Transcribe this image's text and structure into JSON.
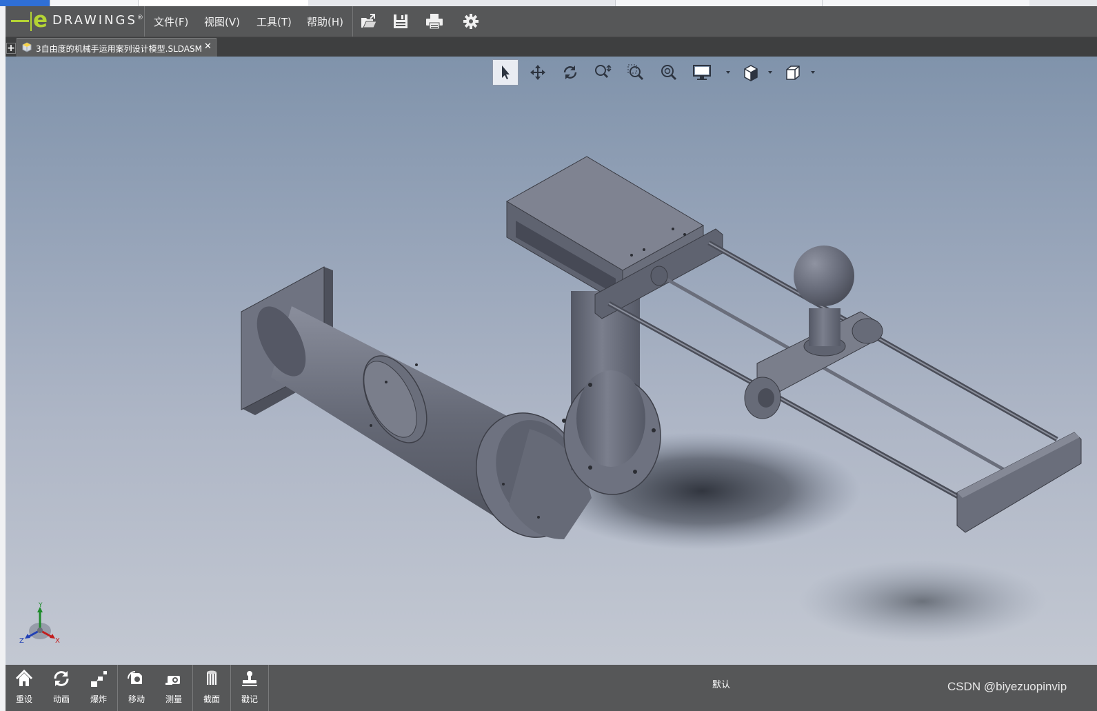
{
  "app": {
    "logo_letter": "e",
    "logo_text": "DRAWINGS",
    "logo_mark": "®"
  },
  "menu": {
    "items": [
      {
        "label": "文件(F)"
      },
      {
        "label": "视图(V)"
      },
      {
        "label": "工具(T)"
      },
      {
        "label": "帮助(H)"
      }
    ]
  },
  "toolbar": {
    "buttons": [
      {
        "icon": "open-folder-icon"
      },
      {
        "icon": "save-icon"
      },
      {
        "icon": "print-icon"
      },
      {
        "icon": "settings-gear-icon"
      }
    ]
  },
  "tabs": {
    "new_tab": "+",
    "document": {
      "title": "3自由度的机械手运用案列设计模型.SLDASM",
      "close": "✕"
    }
  },
  "view_toolbar": {
    "tools": [
      {
        "icon": "select-arrow-icon",
        "active": true
      },
      {
        "icon": "pan-move-icon"
      },
      {
        "icon": "rotate-icon"
      },
      {
        "icon": "zoom-icon"
      },
      {
        "icon": "zoom-to-area-icon"
      },
      {
        "icon": "zoom-to-fit-icon"
      },
      {
        "icon": "display-style-icon",
        "dropdown": true
      },
      {
        "icon": "view-orientation-icon",
        "dropdown": true
      },
      {
        "icon": "standard-view-cube-icon",
        "dropdown": true
      }
    ]
  },
  "triad": {
    "x": "X",
    "y": "Y",
    "z": "Z"
  },
  "bottom_toolbar": {
    "items": [
      {
        "label": "重设",
        "icon": "home-reset-icon"
      },
      {
        "label": "动画",
        "icon": "animate-icon"
      },
      {
        "label": "爆炸",
        "icon": "explode-icon"
      },
      {
        "label": "移动",
        "icon": "move-component-icon"
      },
      {
        "label": "测量",
        "icon": "measure-icon"
      },
      {
        "label": "截面",
        "icon": "section-icon"
      },
      {
        "label": "戳记",
        "icon": "stamp-icon"
      }
    ]
  },
  "status": {
    "configuration": "默认"
  },
  "watermark": "CSDN @biyezuopinvip",
  "colors": {
    "chrome": "#565758",
    "tabbar": "#3e3f40",
    "logo_green": "#b4d334",
    "part_gray": "#6a6e7b"
  }
}
